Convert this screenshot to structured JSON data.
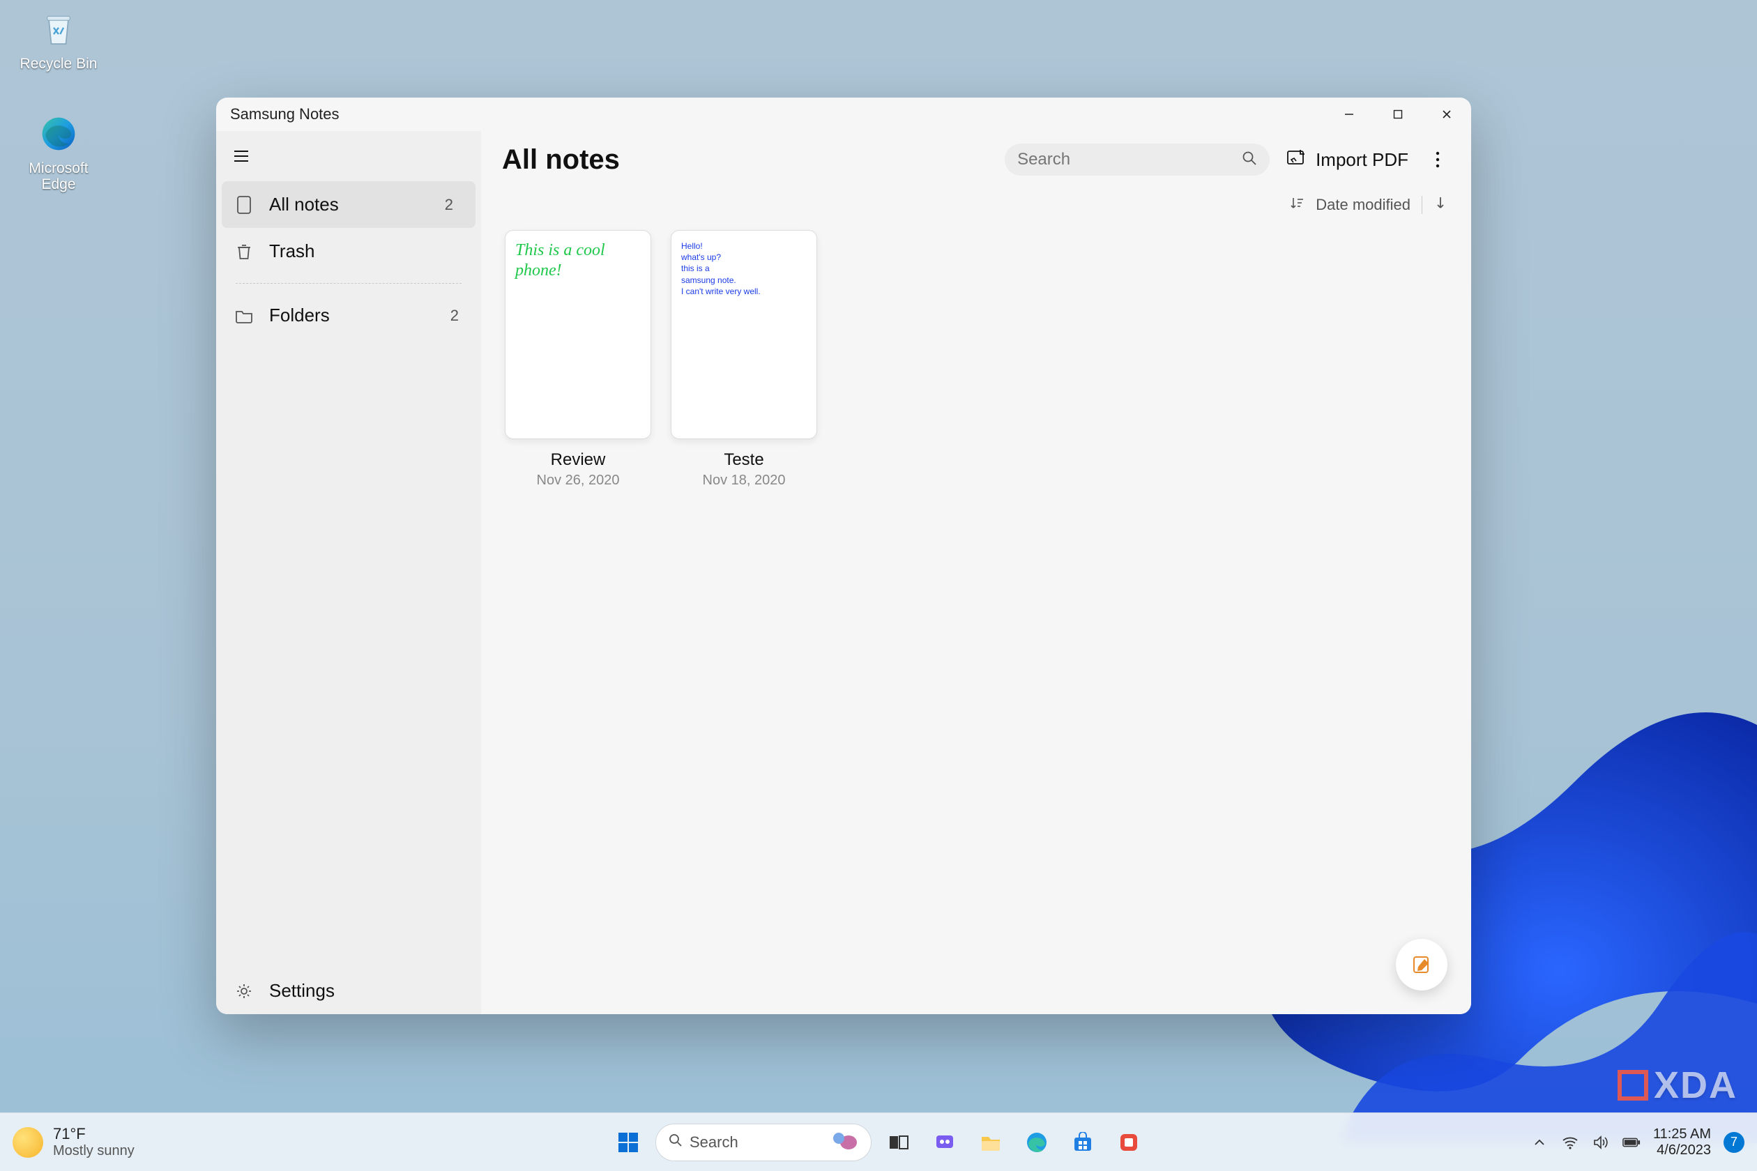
{
  "desktop": {
    "icons": [
      {
        "name": "recycle-bin",
        "label": "Recycle Bin"
      },
      {
        "name": "edge",
        "label": "Microsoft Edge"
      }
    ]
  },
  "window": {
    "title": "Samsung Notes",
    "page_title": "All notes",
    "search_placeholder": "Search",
    "import_label": "Import PDF",
    "sort_label": "Date modified",
    "sidebar": {
      "items": [
        {
          "label": "All notes",
          "count": "2",
          "icon": "note-icon",
          "active": true
        },
        {
          "label": "Trash",
          "count": "",
          "icon": "trash-icon",
          "active": false
        }
      ],
      "folders": {
        "label": "Folders",
        "count": "2"
      },
      "settings_label": "Settings"
    },
    "notes": [
      {
        "title": "Review",
        "date": "Nov 26, 2020",
        "kind": "handwriting",
        "preview": "This is a cool\nphone!"
      },
      {
        "title": "Teste",
        "date": "Nov 18, 2020",
        "kind": "typed",
        "preview": "Hello!\nwhat's up?\nthis is a\nsamsung note.\nI can't write very well."
      }
    ]
  },
  "taskbar": {
    "weather": {
      "temp": "71°F",
      "cond": "Mostly sunny"
    },
    "search_placeholder": "Search",
    "clock": {
      "time": "11:25 AM",
      "date": "4/6/2023"
    },
    "notif_count": "7"
  },
  "watermark": "XDA"
}
